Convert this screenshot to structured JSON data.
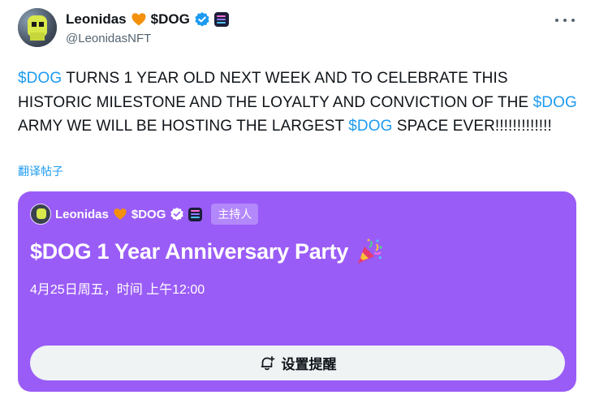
{
  "author": {
    "display_name": "Leonidas",
    "name_suffix": "$DOG",
    "handle": "@LeonidasNFT"
  },
  "tweet": {
    "segments": [
      {
        "text": "$DOG",
        "type": "cashtag"
      },
      {
        "text": " TURNS 1 YEAR OLD NEXT WEEK AND TO CELEBRATE THIS HISTORIC MILESTONE AND THE LOYALTY AND CONVICTION OF THE ",
        "type": "text"
      },
      {
        "text": "$DOG",
        "type": "cashtag"
      },
      {
        "text": " ARMY WE WILL BE HOSTING THE LARGEST ",
        "type": "text"
      },
      {
        "text": "$DOG",
        "type": "cashtag"
      },
      {
        "text": " SPACE EVER!!!!!!!!!!!!!",
        "type": "text"
      }
    ],
    "translate_label": "翻译帖子"
  },
  "space": {
    "host_name": "Leonidas",
    "host_suffix": "$DOG",
    "host_badge": "主持人",
    "title": "$DOG 1 Year Anniversary Party",
    "time": "4月25日周五，时间 上午12:00",
    "remind_label": "设置提醒",
    "background_color": "#9a5cf7"
  },
  "icons": {
    "heart": "orange-heart-icon",
    "verified": "verified-badge-icon",
    "affiliate": "affiliate-badge-icon",
    "more": "more-options-icon",
    "party": "party-popper-icon",
    "bell": "bell-plus-icon"
  },
  "colors": {
    "cashtag": "#1d9bf0",
    "accent": "#1d9bf0",
    "heart": "#f4900c"
  }
}
